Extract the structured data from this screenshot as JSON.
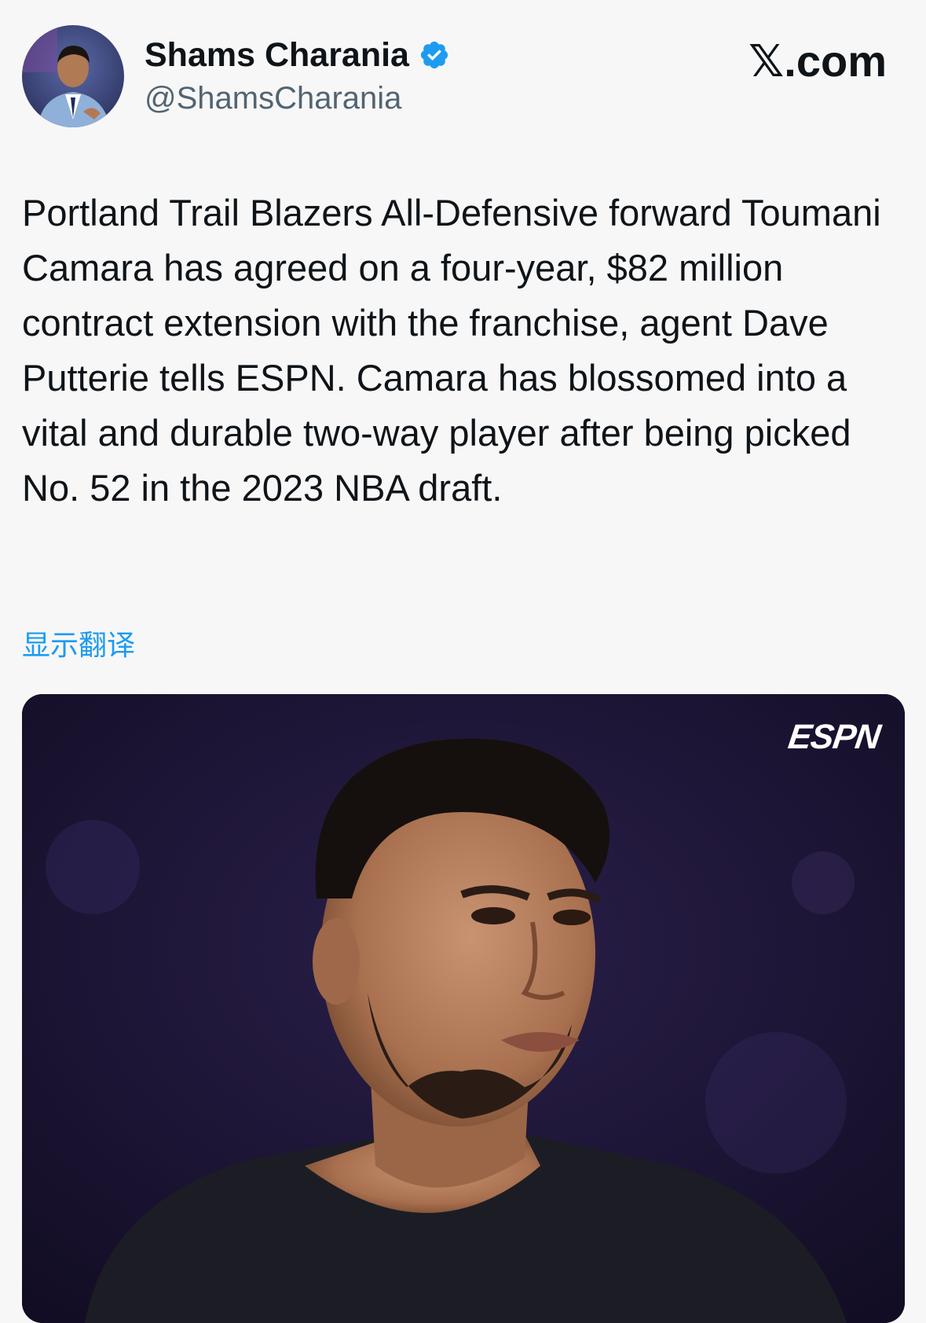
{
  "author": {
    "name": "Shams Charania",
    "handle": "@ShamsCharania",
    "verified": true,
    "verified_color": "#1d9bf0"
  },
  "brand": "𝕏.com",
  "tweet": {
    "text": "Portland Trail Blazers All-Defensive forward Toumani Camara has agreed on a four-year, $82 million contract extension with the franchise, agent Dave Putterie tells ESPN. Camara has blossomed into a vital and durable two-way player after being picked No. 52 in the 2023 NBA draft."
  },
  "translate_label": "显示翻译",
  "media": {
    "watermark": "ESPN"
  },
  "colors": {
    "background": "#f7f7f7",
    "text": "#0f1419",
    "secondary": "#536471",
    "link": "#1d9bf0",
    "media_bg": "#1a1430"
  }
}
